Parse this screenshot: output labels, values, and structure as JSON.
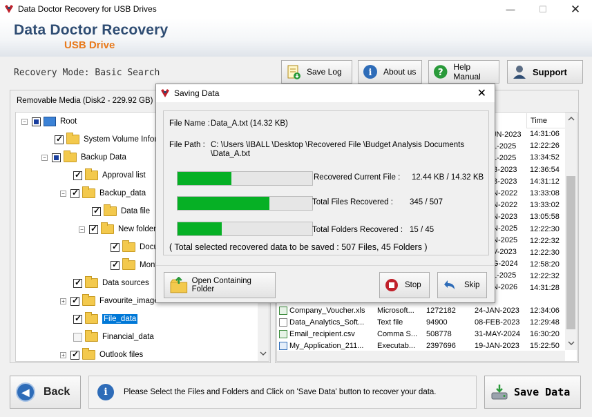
{
  "window": {
    "title": "Data Doctor Recovery for USB Drives",
    "min": "—",
    "max": "☐",
    "close": "✕"
  },
  "banner": {
    "brand": "Data Doctor Recovery",
    "sub": "USB Drive"
  },
  "mode": {
    "text": "Recovery Mode: Basic Search"
  },
  "toolbar": {
    "save_log": "Save Log",
    "about_us": "About us",
    "help_manual": "Help Manual",
    "support": "Support"
  },
  "tree": {
    "media_label": "Removable Media (Disk2 - 229.92 GB)",
    "nodes": [
      {
        "label": "Root"
      },
      {
        "label": "System Volume Inform"
      },
      {
        "label": "Backup Data"
      },
      {
        "label": "Approval list"
      },
      {
        "label": "Backup_data"
      },
      {
        "label": "Data file"
      },
      {
        "label": "New folder"
      },
      {
        "label": "Docu"
      },
      {
        "label": "Mont"
      },
      {
        "label": "Data sources"
      },
      {
        "label": "Favourite_image"
      },
      {
        "label": "File_data"
      },
      {
        "label": "Financial_data"
      },
      {
        "label": "Outlook files"
      }
    ]
  },
  "files": {
    "time_header": "Time",
    "dates": [
      "JN-2023",
      "L-2025",
      "L-2025",
      "B-2023",
      "B-2023",
      "N-2022",
      "N-2022",
      "N-2023",
      "N-2025",
      "N-2025",
      "V-2023",
      "G-2024",
      "L-2025",
      "N-2026"
    ],
    "times": [
      "14:31:06",
      "12:22:26",
      "13:34:52",
      "12:36:54",
      "14:31:12",
      "13:33:08",
      "13:33:02",
      "13:05:58",
      "12:22:30",
      "12:22:32",
      "12:22:30",
      "12:58:20",
      "12:22:32",
      "14:31:28"
    ],
    "rows": [
      {
        "name": "Company_Voucher.xls",
        "type": "Microsoft...",
        "size": "1272182",
        "date": "24-JAN-2023",
        "time": "12:34:06"
      },
      {
        "name": "Data_Analytics_Soft...",
        "type": "Text file",
        "size": "94900",
        "date": "08-FEB-2023",
        "time": "12:29:48"
      },
      {
        "name": "Email_recipient.csv",
        "type": "Comma S...",
        "size": "508778",
        "date": "31-MAY-2024",
        "time": "16:30:20"
      },
      {
        "name": "My_Application_211...",
        "type": "Executab...",
        "size": "2397696",
        "date": "19-JAN-2023",
        "time": "15:22:50"
      }
    ]
  },
  "bottom": {
    "back": "Back",
    "hint": "Please Select the Files and Folders and Click on 'Save Data' button to recover your data.",
    "save_data": "Save Data"
  },
  "dialog": {
    "title": "Saving Data",
    "close": "✕",
    "file_name_label": "File Name :",
    "file_name_value": "Data_A.txt (14.32 KB)",
    "file_path_label": "File Path :",
    "file_path_line1": "C: \\Users \\IBALL \\Desktop \\Recovered File \\Budget Analysis Documents",
    "file_path_line2": "\\Data_A.txt",
    "current_file_label": "Recovered Current File :",
    "current_file_value": "12.44 KB  /  14.32 KB",
    "current_file_progress": 0.4,
    "total_files_label": "Total Files Recovered :",
    "total_files_value": "345 / 507",
    "total_files_progress": 0.68,
    "total_folders_label": "Total Folders Recovered :",
    "total_folders_value": "15 / 45",
    "total_folders_progress": 0.33,
    "summary": "( Total selected recovered data to be saved : 507 Files, 45 Folders )",
    "open_folder": "Open Containing Folder",
    "stop": "Stop",
    "skip": "Skip"
  },
  "colors": {
    "progress_fill": "#06b025",
    "brand_blue": "#2f4d73",
    "brand_orange": "#e87a1c"
  }
}
